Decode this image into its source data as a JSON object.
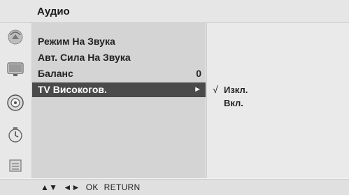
{
  "header": {
    "title": "Аудио"
  },
  "sidebar_icons": [
    {
      "name": "picture-icon"
    },
    {
      "name": "tv-screen-icon"
    },
    {
      "name": "audio-disc-icon"
    },
    {
      "name": "clock-icon"
    },
    {
      "name": "options-icon"
    }
  ],
  "menu": {
    "items": [
      {
        "label": "Режим На Звука",
        "value": ""
      },
      {
        "label": "Авт. Сила На Звука",
        "value": ""
      },
      {
        "label": "Баланс",
        "value": "0"
      },
      {
        "label": "TV Високогов.",
        "value": "",
        "arrow": "►",
        "selected": true
      }
    ]
  },
  "submenu": {
    "items": [
      {
        "label": "Изкл.",
        "check": "√",
        "checked": true
      },
      {
        "label": "Вкл.",
        "check": "",
        "checked": false
      }
    ]
  },
  "footer": {
    "nav_updown": "▲▼",
    "nav_leftright": "◄►",
    "ok": "OK",
    "return": "RETURN"
  },
  "colors": {
    "selected_bg": "#4a4a4a",
    "panel_bg": "#d4d4d4",
    "submenu_bg": "#eaeaea"
  }
}
